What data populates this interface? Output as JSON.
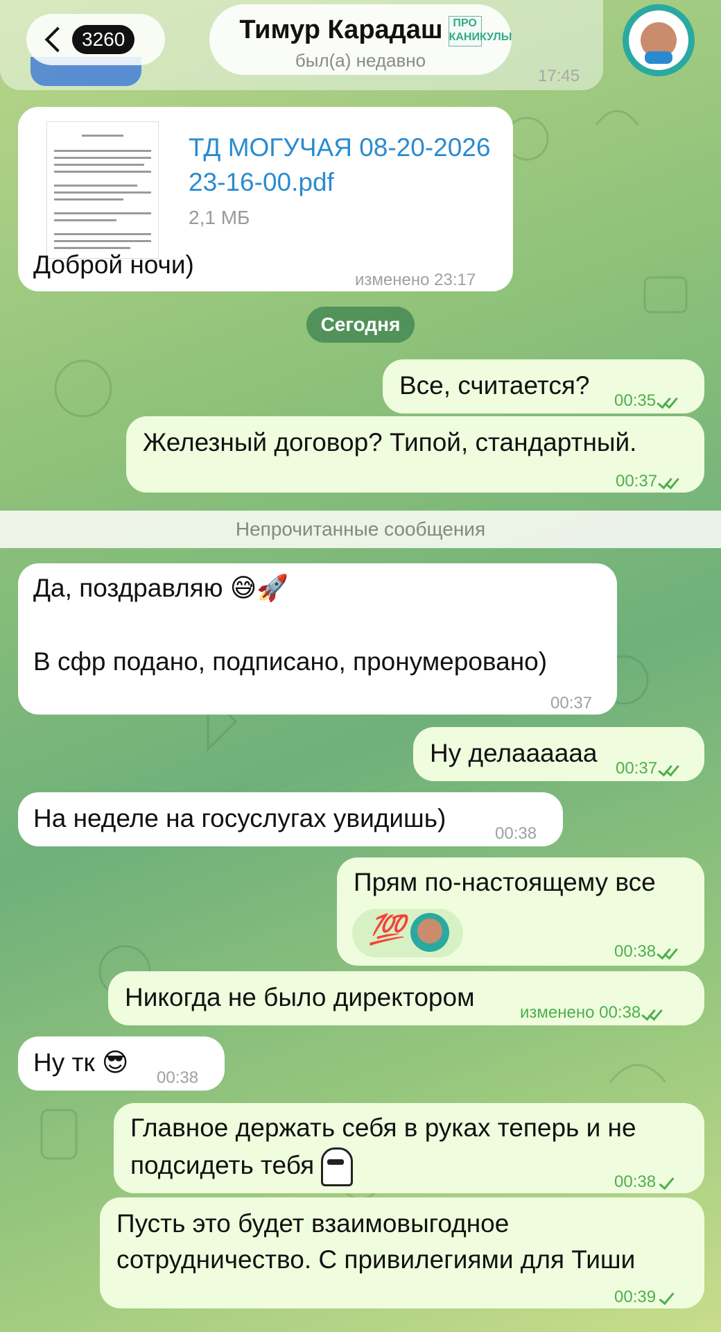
{
  "header": {
    "unread_count": "3260",
    "title": "Тимур Карадаш",
    "title_badge": "ПРО КАНИКУЛЫ",
    "status": "был(а) недавно"
  },
  "previous": {
    "time": "17:45"
  },
  "file_message": {
    "file_name_line1": "ТД МОГУЧАЯ 08-20-2026",
    "file_name_line2": "23-16-00.pdf",
    "file_size": "2,1 МБ",
    "caption": "Доброй ночи)",
    "meta": "изменено 23:17"
  },
  "date_divider": "Сегодня",
  "unread_divider": "Непрочитанные сообщения",
  "messages": [
    {
      "text": "Все, считается?",
      "time": "00:35"
    },
    {
      "text": "Железный договор? Типой, стандартный.",
      "time": "00:37"
    },
    {
      "line1": "Да, поздравляю",
      "emoji1": "😅",
      "emoji2": "🚀",
      "line2": "В сфр подано, подписано, пронумеровано)",
      "time": "00:37"
    },
    {
      "text": "Ну делаааааа",
      "time": "00:37"
    },
    {
      "text": "На неделе на госуслугах увидишь)",
      "time": "00:38"
    },
    {
      "text": "Прям по-настоящему все",
      "emoji": "💯",
      "time": "00:38"
    },
    {
      "text": "Никогда не было директором",
      "meta": "изменено 00:38"
    },
    {
      "text": "Ну тк",
      "emoji": "😎",
      "time": "00:38"
    },
    {
      "line1": "Главное держать себя в руках теперь и не",
      "line2": "подсидеть тебя",
      "time": "00:38"
    },
    {
      "line1": "Пусть это будет взаимовыгодное",
      "line2": "сотрудничество. С привилегиями для Тиши",
      "time": "00:39"
    }
  ],
  "colors": {
    "incoming_bubble": "#ffffff",
    "outgoing_bubble": "#effdde",
    "outgoing_meta": "#4fae4e",
    "link": "#2a8bd0"
  },
  "icons": [
    "back-chevron-icon",
    "double-check-icon",
    "single-check-icon",
    "pdf-document-icon"
  ]
}
